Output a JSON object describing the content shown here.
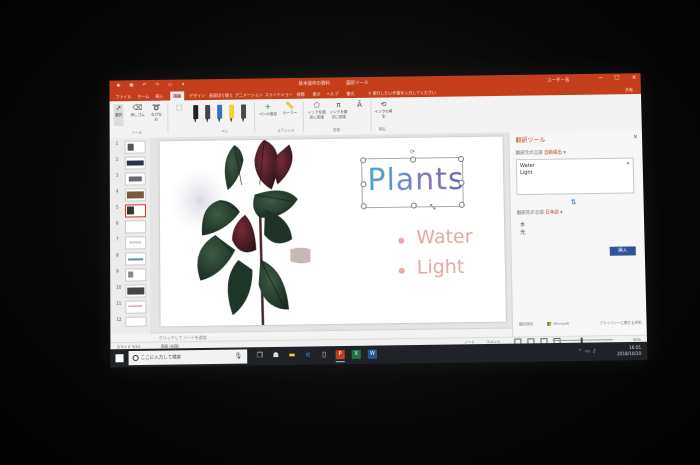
{
  "titlebar": {
    "doc_title": "基本操作の資料",
    "tool_title": "図形ツール",
    "user": "ユーザー名",
    "min": "─",
    "max": "☐",
    "close": "✕"
  },
  "tabs": [
    {
      "label": "ファイル"
    },
    {
      "label": "ホーム"
    },
    {
      "label": "挿入"
    },
    {
      "label": "描画"
    },
    {
      "label": "デザイン"
    },
    {
      "label": "画面切り替え"
    },
    {
      "label": "アニメーション"
    },
    {
      "label": "スライドショー"
    },
    {
      "label": "校閲"
    },
    {
      "label": "表示"
    },
    {
      "label": "ヘルプ"
    },
    {
      "label": "書式"
    }
  ],
  "tell_me": "実行したい作業を入力してください",
  "share_label": "共有",
  "ribbon": {
    "select_label": "選択",
    "eraser_label": "消しゴム",
    "lasso_label": "なげなわ",
    "add_pen_label": "ペンの追加",
    "ruler_label": "ルーラー",
    "ink_to_shape_label": "インクを図形に変換",
    "ink_to_math_label": "インクを数式に変換",
    "replay_label": "インクの再生",
    "groups": [
      "ツール",
      "ペン",
      "ステンシル",
      "変換",
      "再生"
    ]
  },
  "thumbnails": [
    {
      "num": "1"
    },
    {
      "num": "2"
    },
    {
      "num": "3"
    },
    {
      "num": "4"
    },
    {
      "num": "5"
    },
    {
      "num": "6"
    },
    {
      "num": "7"
    },
    {
      "num": "8"
    },
    {
      "num": "9"
    },
    {
      "num": "10"
    },
    {
      "num": "11"
    },
    {
      "num": "12"
    }
  ],
  "slide": {
    "title": "Plants",
    "bullets": [
      "Water",
      "Light"
    ]
  },
  "notes_placeholder": "クリックしてノートを追加",
  "translator": {
    "title": "翻訳ツール",
    "source_label": "翻訳元の言語",
    "source_lang": "自動検出",
    "source_text": [
      "Water",
      "Light"
    ],
    "target_label": "翻訳先の言語",
    "target_lang": "日本語",
    "target_text": [
      "水",
      "光"
    ],
    "insert_label": "挿入",
    "footer_left": "翻訳提供",
    "footer_brand": "Microsoft",
    "footer_right": "プライバシーに関する声明"
  },
  "statusbar": {
    "slide_info": "スライド 5/12",
    "language": "英語 (米国)",
    "notes": "ノート",
    "comments": "コメント",
    "zoom": "50%"
  },
  "taskbar": {
    "search_placeholder": "ここに入力して検索",
    "time": "16:01",
    "date": "2018/10/10"
  },
  "colors": {
    "accent": "#c43e1c",
    "taskbar": "#1f2327",
    "insert_button": "#2b579a",
    "bullet_text": "#e3a79f"
  }
}
